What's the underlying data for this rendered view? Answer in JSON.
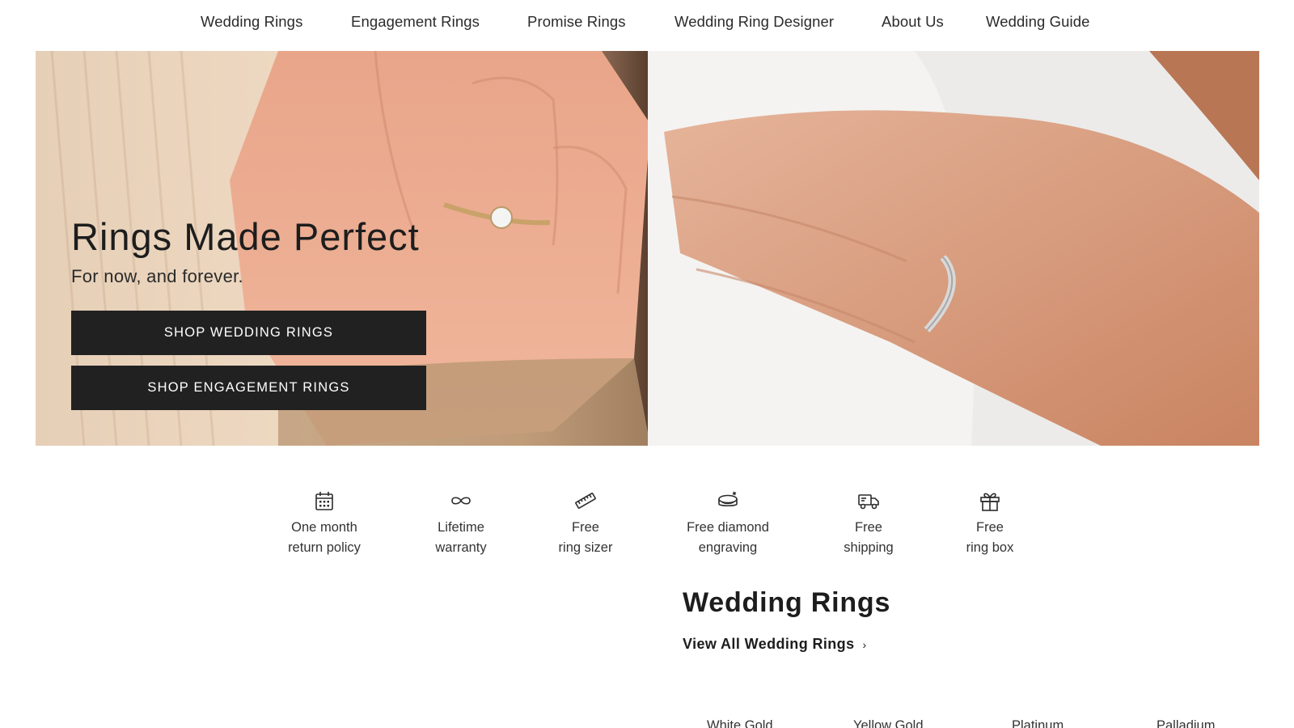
{
  "nav": {
    "items": [
      {
        "label": "Wedding Rings"
      },
      {
        "label": "Engagement Rings"
      },
      {
        "label": "Promise Rings"
      },
      {
        "label": "Wedding Ring Designer"
      },
      {
        "label": "About Us"
      },
      {
        "label": "Wedding Guide"
      }
    ]
  },
  "hero": {
    "title": "Rings Made Perfect",
    "subtitle": "For now, and forever.",
    "buttons": {
      "wedding": "SHOP WEDDING RINGS",
      "engagement": "SHOP ENGAGEMENT RINGS"
    }
  },
  "perks": [
    {
      "icon": "calendar-icon",
      "text": "One month\nreturn policy"
    },
    {
      "icon": "infinity-icon",
      "text": "Lifetime\nwarranty"
    },
    {
      "icon": "ruler-icon",
      "text": "Free\nring sizer"
    },
    {
      "icon": "ring-engraving-icon",
      "text": "Free diamond\nengraving"
    },
    {
      "icon": "truck-icon",
      "text": "Free\nshipping"
    },
    {
      "icon": "gift-icon",
      "text": "Free\nring box"
    }
  ],
  "wedding_rings": {
    "title": "Wedding Rings",
    "view_all": "View All Wedding Rings",
    "metals": [
      "White Gold",
      "Yellow Gold",
      "Platinum",
      "Palladium"
    ]
  },
  "colors": {
    "button_bg": "#212121",
    "text": "#1d1d1d"
  }
}
